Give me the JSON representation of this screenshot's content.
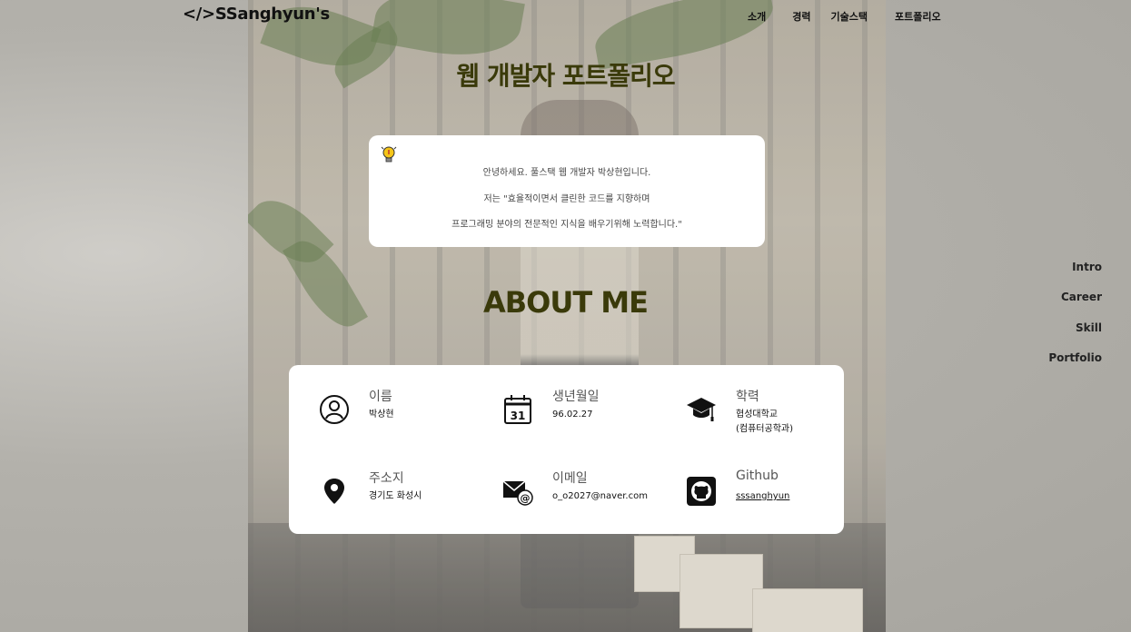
{
  "header": {
    "logo": "</>SSanghyun's",
    "nav": [
      "소개",
      "경력",
      "기술스택",
      "포트폴리오"
    ]
  },
  "hero": {
    "title": "웹 개발자 포트폴리오",
    "intro": [
      "안녕하세요. 풀스택 웹 개발자 박상현입니다.",
      "저는 \"효율적이면서 클린한 코드를 지향하며",
      "프로그래밍 분야의 전문적인 지식을 배우기위해 노력합니다.\""
    ]
  },
  "about": {
    "title": "ABOUT ME",
    "items": [
      {
        "label": "이름",
        "value": "박상현",
        "icon": "person-icon"
      },
      {
        "label": "생년월일",
        "value": "96.02.27",
        "icon": "calendar-icon"
      },
      {
        "label": "학력",
        "value": "협성대학교\n(컴퓨터공학과)",
        "icon": "graduation-cap-icon"
      },
      {
        "label": "주소지",
        "value": "경기도 화성시",
        "icon": "location-pin-icon"
      },
      {
        "label": "이메일",
        "value": "o_o2027@naver.com",
        "icon": "email-icon"
      },
      {
        "label": "Github",
        "value": "sssanghyun",
        "icon": "github-icon"
      }
    ],
    "calendar_day": "31"
  },
  "side_nav": [
    "Intro",
    "Career",
    "Skill",
    "Portfolio"
  ],
  "colors": {
    "title": "#3a3a0a",
    "card": "#ffffff"
  }
}
